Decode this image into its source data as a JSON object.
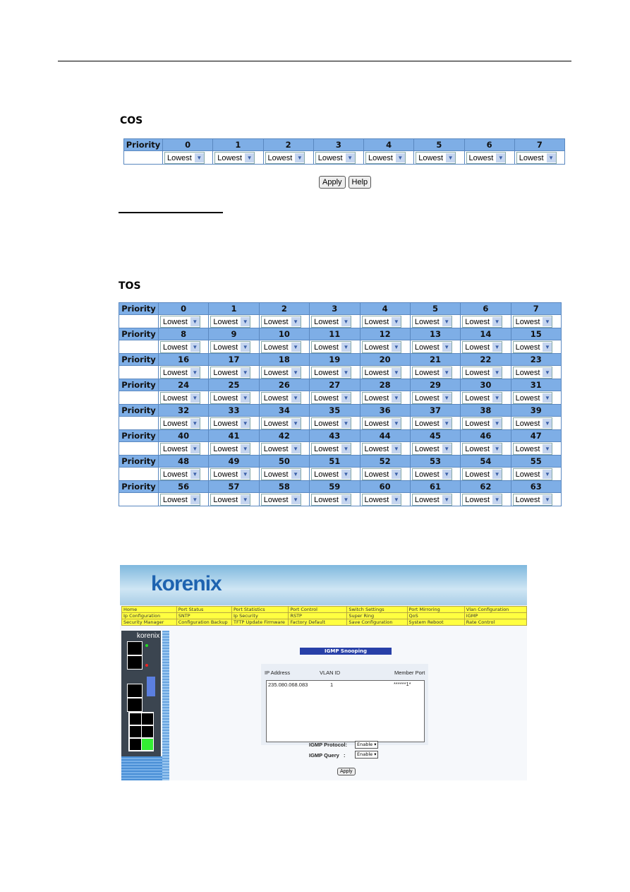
{
  "cos": {
    "title": "COS",
    "priority_label": "Priority",
    "columns": [
      "0",
      "1",
      "2",
      "3",
      "4",
      "5",
      "6",
      "7"
    ],
    "values": [
      "Lowest",
      "Lowest",
      "Lowest",
      "Lowest",
      "Lowest",
      "Lowest",
      "Lowest",
      "Lowest"
    ],
    "apply": "Apply",
    "help": "Help"
  },
  "tos": {
    "title": "TOS",
    "priority_label": "Priority",
    "value": "Lowest",
    "rows": [
      [
        "0",
        "1",
        "2",
        "3",
        "4",
        "5",
        "6",
        "7"
      ],
      [
        "8",
        "9",
        "10",
        "11",
        "12",
        "13",
        "14",
        "15"
      ],
      [
        "16",
        "17",
        "18",
        "19",
        "20",
        "21",
        "22",
        "23"
      ],
      [
        "24",
        "25",
        "26",
        "27",
        "28",
        "29",
        "30",
        "31"
      ],
      [
        "32",
        "33",
        "34",
        "35",
        "36",
        "37",
        "38",
        "39"
      ],
      [
        "40",
        "41",
        "42",
        "43",
        "44",
        "45",
        "46",
        "47"
      ],
      [
        "48",
        "49",
        "50",
        "51",
        "52",
        "53",
        "54",
        "55"
      ],
      [
        "56",
        "57",
        "58",
        "59",
        "60",
        "61",
        "62",
        "63"
      ]
    ]
  },
  "korenix": {
    "logo": "korenix",
    "device_logo": "korenix",
    "menu": [
      [
        "Home",
        "Port Status",
        "Port Statistics",
        "Port Control",
        "Switch Settings",
        "Port Mirroring",
        "Vlan Configuration"
      ],
      [
        "Ip Configuration",
        "SNTP",
        "Ip Security",
        "RSTP",
        "Super Ring",
        "QoS",
        "IGMP"
      ],
      [
        "Security Manager",
        "Configuration Backup",
        "TFTP Update Firmware",
        "Factory Default",
        "Save Configuration",
        "System Reboot",
        "Rate Control"
      ]
    ],
    "igmp_title": "IGMP Snooping",
    "col_ip": "IP Address",
    "col_vlan": "VLAN ID",
    "col_member": "Member Port",
    "entry": {
      "ip": "235.080.068.083",
      "vlan": "1",
      "member": "******1*"
    },
    "protocol_label": "IGMP Protocol:",
    "protocol_value": "Enable",
    "query_label": "IGMP Query   :",
    "query_value": "Enable",
    "apply": "Apply"
  }
}
